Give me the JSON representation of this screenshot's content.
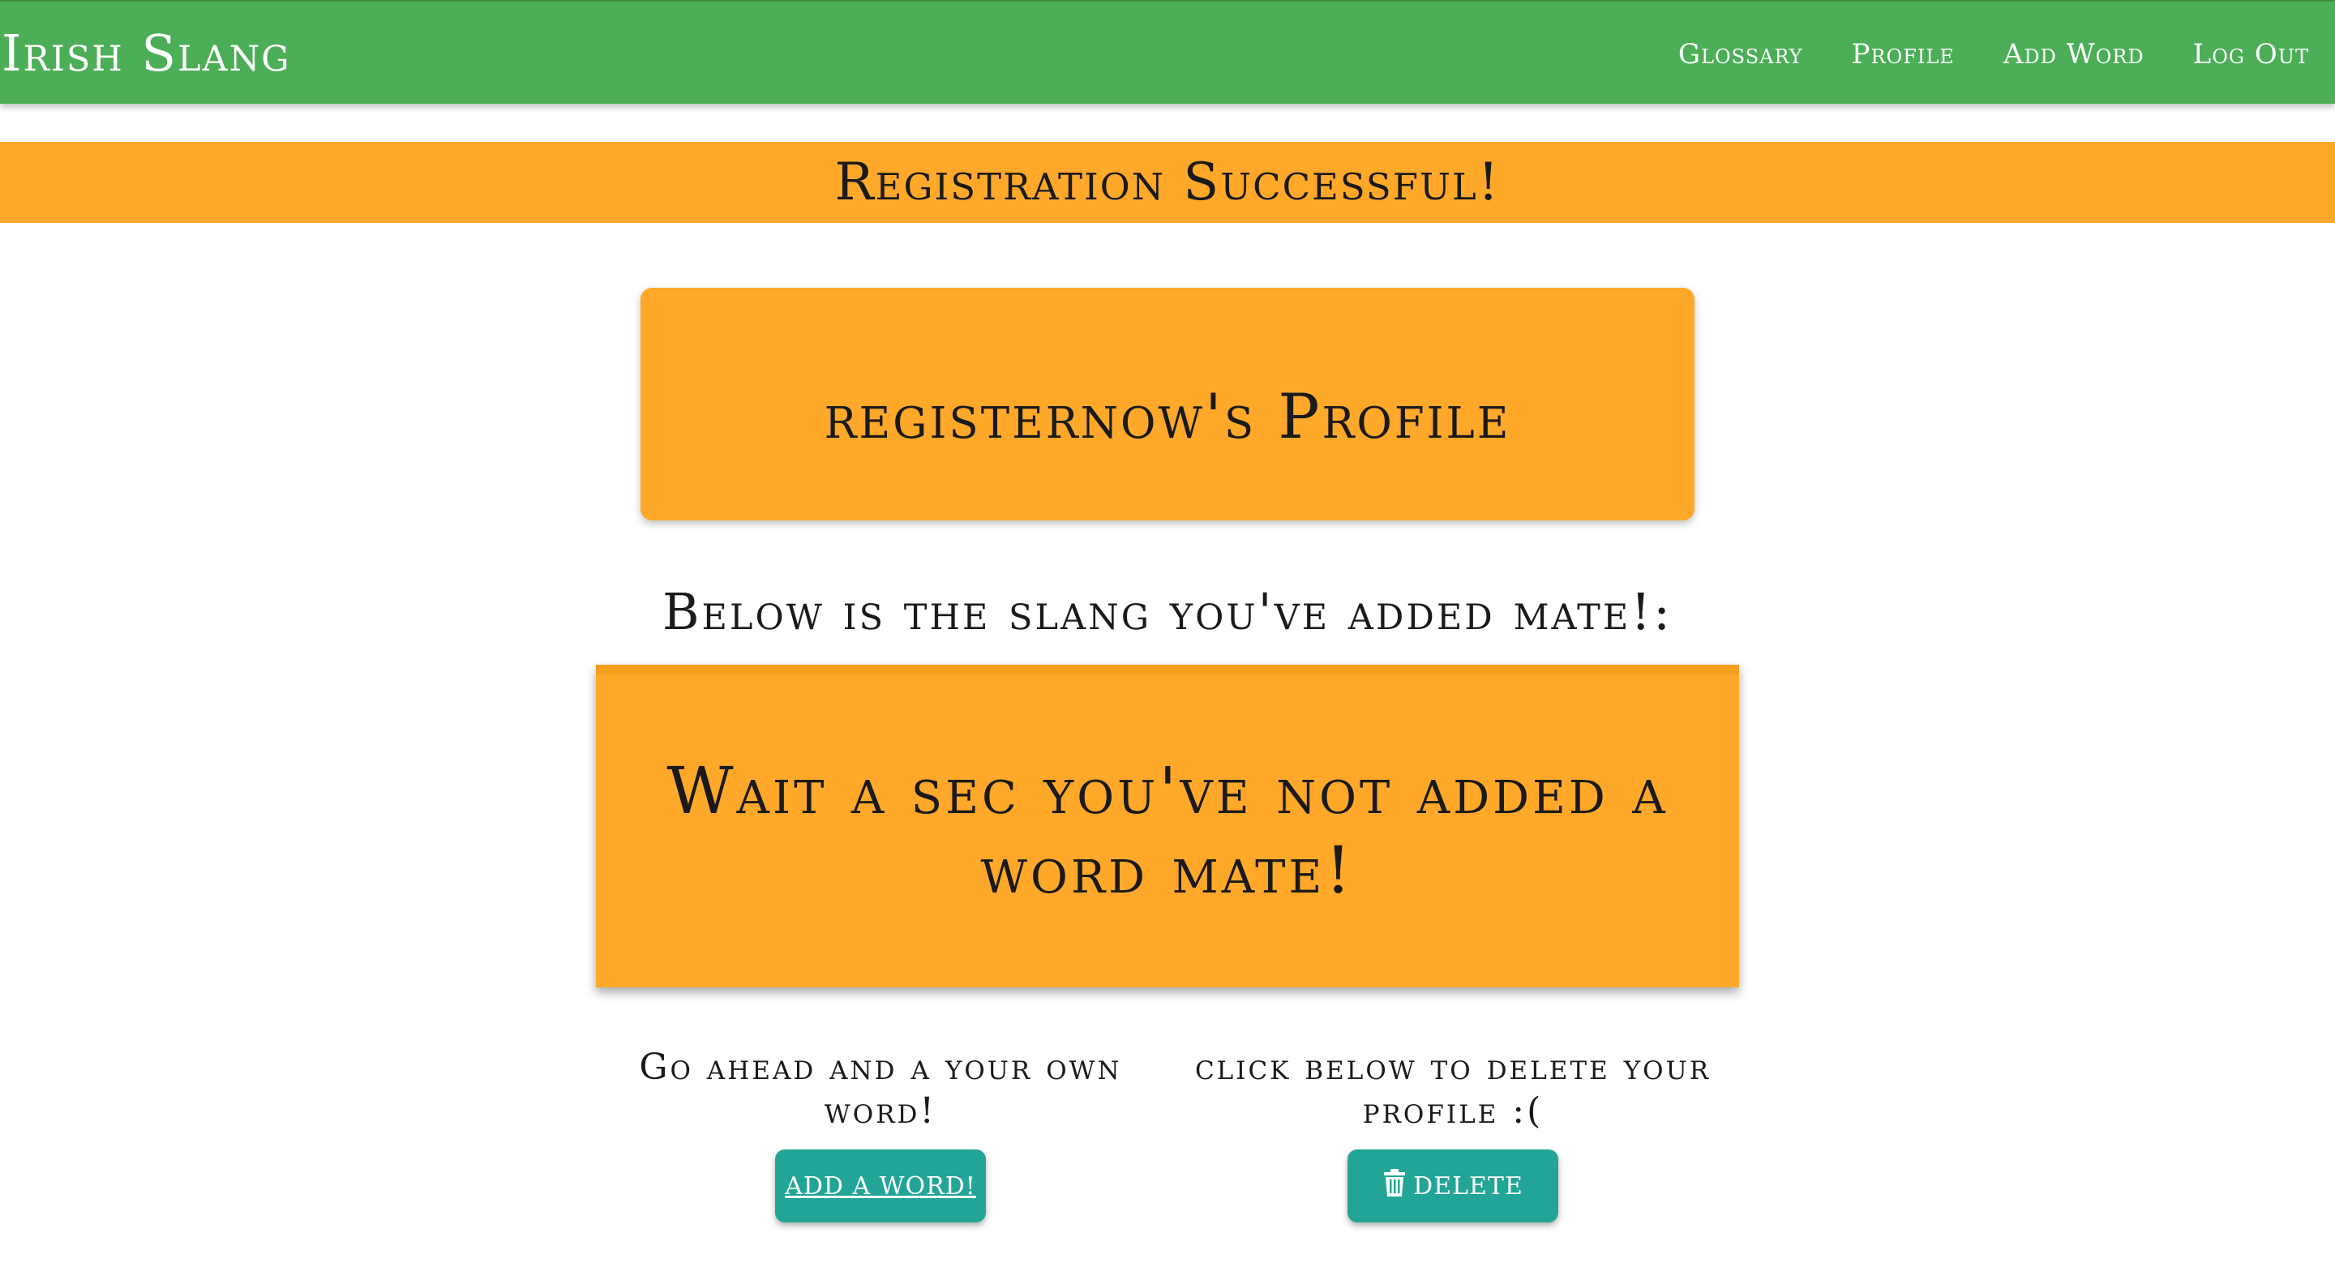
{
  "navbar": {
    "brand": "Irish Slang",
    "links": [
      "Glossary",
      "Profile",
      "Add Word",
      "Log Out"
    ]
  },
  "flash": {
    "message": "Registration Successful!"
  },
  "profile": {
    "title": "registernow's Profile"
  },
  "slang_section": {
    "heading": "Below is the slang you've added mate!:",
    "empty_message": "Wait a sec you've not added a word mate!"
  },
  "actions": {
    "add_prompt": "Go ahead and a your own word!",
    "add_button": "ADD A WORD!",
    "delete_prompt": "click below to delete your profile :(",
    "delete_button": "DELETE",
    "delete_icon": "trash-icon"
  },
  "colors": {
    "navbar": "#4caf57",
    "accent_orange": "#ffa82a",
    "button_teal": "#22a596"
  }
}
